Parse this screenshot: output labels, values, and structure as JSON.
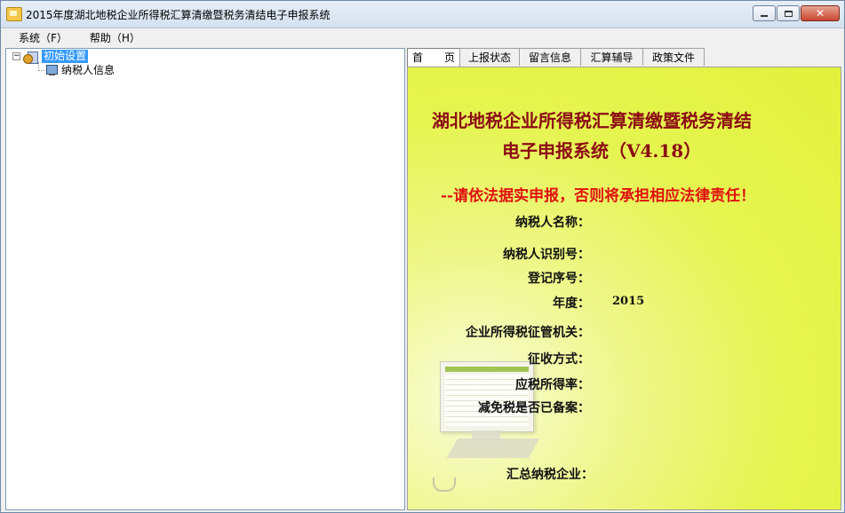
{
  "window": {
    "title": "2015年度湖北地税企业所得税汇算清缴暨税务清结电子申报系统"
  },
  "menu": {
    "items": [
      "系统（F）",
      "帮助（H）"
    ]
  },
  "tree": {
    "root_label": "初始设置",
    "child_label": "纳税人信息",
    "expander": "−"
  },
  "tabs": [
    "首　　页",
    "上报状态",
    "留言信息",
    "汇算辅导",
    "政策文件"
  ],
  "home": {
    "heading_line1": "湖北地税企业所得税汇算清缴暨税务清结",
    "heading_line2": "电子申报系统（V4.18）",
    "warning": "--请依法据实申报，否则将承担相应法律责任！",
    "fields": [
      {
        "label": "纳税人名称：",
        "value": ""
      },
      {
        "label": "纳税人识别号：",
        "value": ""
      },
      {
        "label": "登记序号：",
        "value": ""
      },
      {
        "label": "年度：",
        "value": "2015"
      },
      {
        "label": "企业所得税征管机关：",
        "value": ""
      },
      {
        "label": "征收方式：",
        "value": ""
      },
      {
        "label": "应税所得率：",
        "value": ""
      },
      {
        "label": "减免税是否已备案：",
        "value": ""
      },
      {
        "label": "汇总纳税企业：",
        "value": ""
      }
    ]
  },
  "colors": {
    "heading": "#8b0a14",
    "warning": "#e01010",
    "background": "#e2f23b",
    "selection": "#3399ff"
  }
}
